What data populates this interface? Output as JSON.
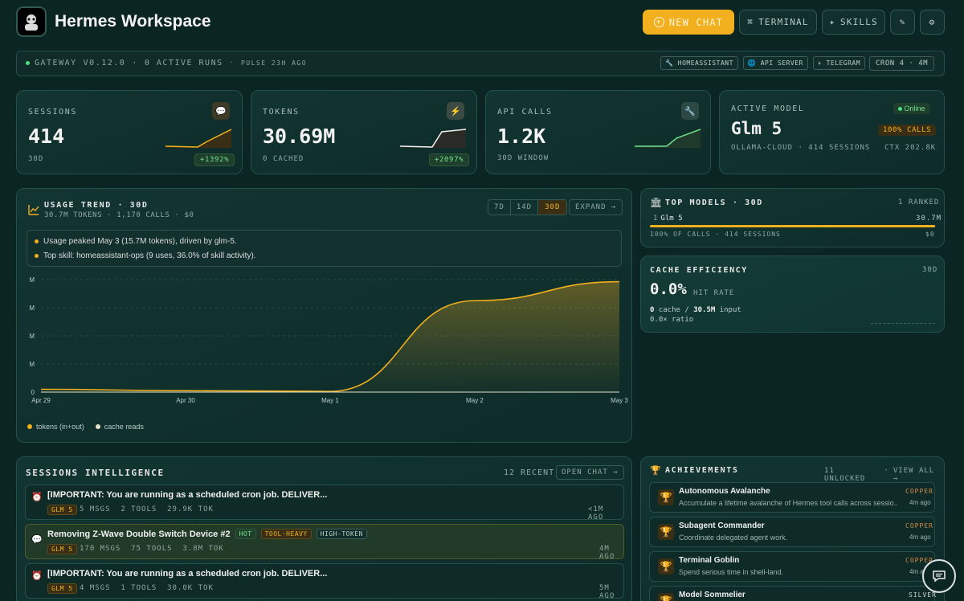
{
  "header": {
    "title": "Hermes Workspace",
    "new_chat": "NEW CHAT",
    "terminal": "TERMINAL",
    "skills": "SKILLS"
  },
  "gateway": {
    "label": "GATEWAY",
    "version": "V0.12.0",
    "sep1": "·",
    "runs": "0 ACTIVE RUNS",
    "sep2": "·",
    "pulse": "PULSE 23H AGO",
    "badges": [
      "HOMEASSISTANT",
      "API SERVER",
      "TELEGRAM"
    ],
    "cron": "CRON 4 · 4M"
  },
  "cards": [
    {
      "label": "SESSIONS",
      "value": "414",
      "sub": "30D",
      "delta": "+1392%",
      "icon": "💬"
    },
    {
      "label": "TOKENS",
      "value": "30.69M",
      "sub": "0 CACHED",
      "delta": "+2097%",
      "icon": "⚡"
    },
    {
      "label": "API CALLS",
      "value": "1.2K",
      "sub": "30D WINDOW",
      "icon": "🔧"
    }
  ],
  "model": {
    "label": "ACTIVE MODEL",
    "status": "Online",
    "name": "Glm 5",
    "calls": "100% CALLS",
    "provider": "OLLAMA-CLOUD · 414 SESSIONS",
    "ctx": "CTX 202.8K"
  },
  "usage": {
    "title": "USAGE TREND · 30D",
    "summary": "30.7M TOKENS · 1,170 CALLS · $0",
    "ranges": [
      "7D",
      "14D",
      "30D"
    ],
    "expand": "EXPAND →",
    "insights": [
      "Usage peaked May 3 (15.7M tokens), driven by glm-5.",
      "Top skill: homeassistant-ops (9 uses, 36.0% of skill activity)."
    ],
    "legend": [
      "tokens (in+out)",
      "cache reads"
    ]
  },
  "chart_data": {
    "type": "area",
    "x": [
      "Apr 29",
      "Apr 30",
      "May 1",
      "May 2",
      "May 3"
    ],
    "yticks": [
      "0",
      "M",
      "M",
      "M",
      "M"
    ],
    "yticks_display": [
      "0",
      "1M",
      "1M",
      "1M",
      "1M"
    ],
    "series": [
      {
        "name": "tokens (in+out)",
        "values": [
          0.4,
          0.2,
          0.1,
          13.0,
          15.7
        ],
        "color": "#f2b01e"
      },
      {
        "name": "cache reads",
        "values": [
          0,
          0,
          0,
          0,
          0
        ],
        "color": "#e8e2c8"
      }
    ],
    "ylim": [
      0,
      16
    ]
  },
  "top_models": {
    "title": "TOP MODELS · 30D",
    "ranked": "1 RANKED",
    "rank": "1",
    "name": "Glm 5",
    "amount": "30.7M",
    "share": 1.0,
    "foot_left": "100% OF CALLS · 414 SESSIONS",
    "foot_right": "$0"
  },
  "cache": {
    "title": "CACHE EFFICIENCY",
    "period": "30D",
    "value": "0.0%",
    "value_label": "HIT RATE",
    "line1_a": "0",
    "line1_b": "cache /",
    "line1_c": "30.5M",
    "line1_d": "input",
    "line2": "0.0× ratio"
  },
  "sessions": {
    "title": "SESSIONS INTELLIGENCE",
    "count": "12 RECENT",
    "open": "OPEN CHAT →",
    "items": [
      {
        "title": "[IMPORTANT: You are running as a scheduled cron job. DELIVER...",
        "model": "GLM 5",
        "meta": "5 MSGS  2 TOOLS  29.9K TOK",
        "time": "<1M AGO",
        "tags": []
      },
      {
        "title": "Removing Z-Wave Double Switch Device #2",
        "model": "GLM 5",
        "meta": "170 MSGS  75 TOOLS  3.8M TOK",
        "time": "4M AGO",
        "tags": [
          "HOT",
          "TOOL-HEAVY",
          "HIGH-TOKEN"
        ]
      },
      {
        "title": "[IMPORTANT: You are running as a scheduled cron job. DELIVER...",
        "model": "GLM 5",
        "meta": "4 MSGS  1 TOOLS  30.0K TOK",
        "time": "5M AGO",
        "tags": []
      }
    ]
  },
  "achievements": {
    "title": "ACHIEVEMENTS",
    "unlocked": "11 UNLOCKED",
    "sep": "·",
    "view_all": "VIEW ALL →",
    "items": [
      {
        "name": "Autonomous Avalanche",
        "desc": "Accumulate a lifetime avalanche of Hermes tool calls across sessio...",
        "tier": "COPPER",
        "time": "4m ago"
      },
      {
        "name": "Subagent Commander",
        "desc": "Coordinate delegated agent work.",
        "tier": "COPPER",
        "time": "4m ago"
      },
      {
        "name": "Terminal Goblin",
        "desc": "Spend serious time in shell-land.",
        "tier": "COPPER",
        "time": "4m ago"
      },
      {
        "name": "Model Sommelier",
        "desc": "",
        "tier": "SILVER",
        "time": ""
      }
    ]
  },
  "colors": {
    "accent": "#f2b01e",
    "bg": "#0b2522",
    "green": "#4ade80"
  }
}
